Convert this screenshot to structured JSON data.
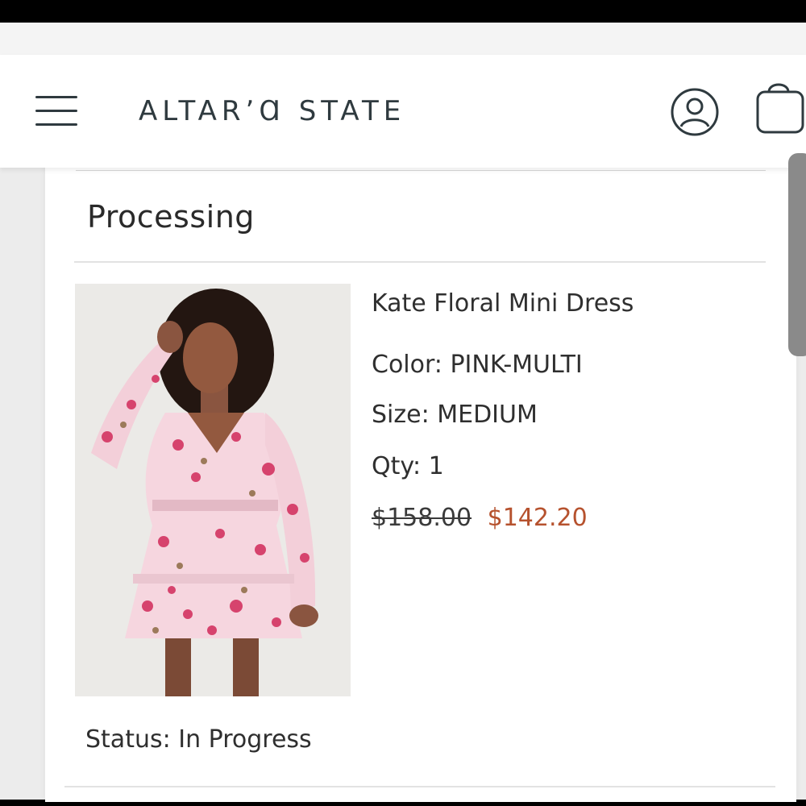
{
  "header": {
    "logo_text": "ALTAR’Ɑ STATE",
    "menu_icon": "hamburger-menu-icon",
    "account_icon": "user-account-icon",
    "bag_icon": "shopping-bag-icon"
  },
  "order": {
    "section_title": "Processing",
    "item": {
      "name": "Kate Floral Mini Dress",
      "color_label": "Color: PINK-MULTI",
      "size_label": "Size: MEDIUM",
      "qty_label": "Qty: 1",
      "original_price": "$158.00",
      "sale_price": "$142.20"
    },
    "status": "Status: In Progress"
  },
  "colors": {
    "brand_text": "#2f3a3f",
    "sale_price": "#b6522e"
  }
}
